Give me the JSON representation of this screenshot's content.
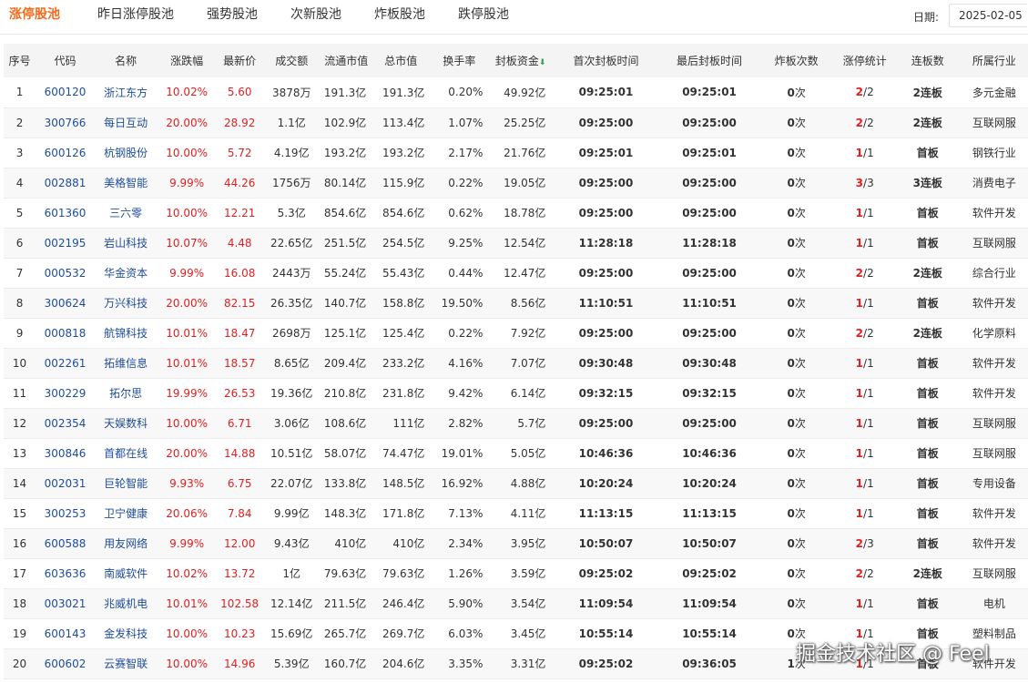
{
  "tabs": [
    "涨停股池",
    "昨日涨停股池",
    "强势股池",
    "次新股池",
    "炸板股池",
    "跌停股池"
  ],
  "date": {
    "label": "日期:",
    "value": "2025-02-05"
  },
  "table": {
    "headers": [
      "序号",
      "代码",
      "名称",
      "涨跌幅",
      "最新价",
      "成交额",
      "流通市值",
      "总市值",
      "换手率",
      "封板资金",
      "首次封板时间",
      "最后封板时间",
      "炸板次数",
      "涨停统计",
      "连板数",
      "所属行业"
    ],
    "rows": [
      {
        "idx": "1",
        "code": "600120",
        "name": "浙江东方",
        "pct": "10.02%",
        "price": "5.60",
        "amount": "3878万",
        "float_cap": "191.3亿",
        "total_cap": "191.3亿",
        "turnover": "0.20%",
        "seal": "49.92亿",
        "first": "09:25:01",
        "last": "09:25:01",
        "zb": "0",
        "zb_unit": "次",
        "zt_n": "2",
        "zt_d": "/2",
        "lb": "2连板",
        "industry": "多元金融"
      },
      {
        "idx": "2",
        "code": "300766",
        "name": "每日互动",
        "pct": "20.00%",
        "price": "28.92",
        "amount": "1.1亿",
        "float_cap": "102.9亿",
        "total_cap": "113.4亿",
        "turnover": "1.07%",
        "seal": "25.25亿",
        "first": "09:25:00",
        "last": "09:25:00",
        "zb": "0",
        "zb_unit": "次",
        "zt_n": "2",
        "zt_d": "/2",
        "lb": "2连板",
        "industry": "互联网服"
      },
      {
        "idx": "3",
        "code": "600126",
        "name": "杭钢股份",
        "pct": "10.00%",
        "price": "5.72",
        "amount": "4.19亿",
        "float_cap": "193.2亿",
        "total_cap": "193.2亿",
        "turnover": "2.17%",
        "seal": "21.76亿",
        "first": "09:25:01",
        "last": "09:25:01",
        "zb": "0",
        "zb_unit": "次",
        "zt_n": "1",
        "zt_d": "/1",
        "lb": "首板",
        "industry": "钢铁行业"
      },
      {
        "idx": "4",
        "code": "002881",
        "name": "美格智能",
        "pct": "9.99%",
        "price": "44.26",
        "amount": "1756万",
        "float_cap": "80.14亿",
        "total_cap": "115.9亿",
        "turnover": "0.22%",
        "seal": "19.05亿",
        "first": "09:25:00",
        "last": "09:25:00",
        "zb": "0",
        "zb_unit": "次",
        "zt_n": "3",
        "zt_d": "/3",
        "lb": "3连板",
        "industry": "消费电子"
      },
      {
        "idx": "5",
        "code": "601360",
        "name": "三六零",
        "pct": "10.00%",
        "price": "12.21",
        "amount": "5.3亿",
        "float_cap": "854.6亿",
        "total_cap": "854.6亿",
        "turnover": "0.62%",
        "seal": "18.78亿",
        "first": "09:25:00",
        "last": "09:25:00",
        "zb": "0",
        "zb_unit": "次",
        "zt_n": "1",
        "zt_d": "/1",
        "lb": "首板",
        "industry": "软件开发"
      },
      {
        "idx": "6",
        "code": "002195",
        "name": "岩山科技",
        "pct": "10.07%",
        "price": "4.48",
        "amount": "22.65亿",
        "float_cap": "251.5亿",
        "total_cap": "254.5亿",
        "turnover": "9.25%",
        "seal": "12.54亿",
        "first": "11:28:18",
        "last": "11:28:18",
        "zb": "0",
        "zb_unit": "次",
        "zt_n": "1",
        "zt_d": "/1",
        "lb": "首板",
        "industry": "互联网服"
      },
      {
        "idx": "7",
        "code": "000532",
        "name": "华金资本",
        "pct": "9.99%",
        "price": "16.08",
        "amount": "2443万",
        "float_cap": "55.24亿",
        "total_cap": "55.43亿",
        "turnover": "0.44%",
        "seal": "12.47亿",
        "first": "09:25:00",
        "last": "09:25:00",
        "zb": "0",
        "zb_unit": "次",
        "zt_n": "2",
        "zt_d": "/2",
        "lb": "2连板",
        "industry": "综合行业"
      },
      {
        "idx": "8",
        "code": "300624",
        "name": "万兴科技",
        "pct": "20.00%",
        "price": "82.15",
        "amount": "26.35亿",
        "float_cap": "140.7亿",
        "total_cap": "158.8亿",
        "turnover": "19.50%",
        "seal": "8.56亿",
        "first": "11:10:51",
        "last": "11:10:51",
        "zb": "0",
        "zb_unit": "次",
        "zt_n": "1",
        "zt_d": "/1",
        "lb": "首板",
        "industry": "软件开发"
      },
      {
        "idx": "9",
        "code": "000818",
        "name": "航锦科技",
        "pct": "10.01%",
        "price": "18.47",
        "amount": "2698万",
        "float_cap": "125.1亿",
        "total_cap": "125.4亿",
        "turnover": "0.22%",
        "seal": "7.92亿",
        "first": "09:25:00",
        "last": "09:25:00",
        "zb": "0",
        "zb_unit": "次",
        "zt_n": "2",
        "zt_d": "/2",
        "lb": "2连板",
        "industry": "化学原料"
      },
      {
        "idx": "10",
        "code": "002261",
        "name": "拓维信息",
        "pct": "10.01%",
        "price": "18.57",
        "amount": "8.65亿",
        "float_cap": "209.4亿",
        "total_cap": "233.2亿",
        "turnover": "4.16%",
        "seal": "7.07亿",
        "first": "09:30:48",
        "last": "09:30:48",
        "zb": "0",
        "zb_unit": "次",
        "zt_n": "1",
        "zt_d": "/1",
        "lb": "首板",
        "industry": "软件开发"
      },
      {
        "idx": "11",
        "code": "300229",
        "name": "拓尔思",
        "pct": "19.99%",
        "price": "26.53",
        "amount": "19.36亿",
        "float_cap": "210.8亿",
        "total_cap": "231.8亿",
        "turnover": "9.42%",
        "seal": "6.14亿",
        "first": "09:32:15",
        "last": "09:32:15",
        "zb": "0",
        "zb_unit": "次",
        "zt_n": "1",
        "zt_d": "/1",
        "lb": "首板",
        "industry": "软件开发"
      },
      {
        "idx": "12",
        "code": "002354",
        "name": "天娱数科",
        "pct": "10.00%",
        "price": "6.71",
        "amount": "3.06亿",
        "float_cap": "108.6亿",
        "total_cap": "111亿",
        "turnover": "2.82%",
        "seal": "5.7亿",
        "first": "09:25:00",
        "last": "09:25:00",
        "zb": "0",
        "zb_unit": "次",
        "zt_n": "1",
        "zt_d": "/1",
        "lb": "首板",
        "industry": "互联网服"
      },
      {
        "idx": "13",
        "code": "300846",
        "name": "首都在线",
        "pct": "20.00%",
        "price": "14.88",
        "amount": "10.51亿",
        "float_cap": "58.07亿",
        "total_cap": "74.47亿",
        "turnover": "19.01%",
        "seal": "5.05亿",
        "first": "10:46:36",
        "last": "10:46:36",
        "zb": "0",
        "zb_unit": "次",
        "zt_n": "1",
        "zt_d": "/1",
        "lb": "首板",
        "industry": "互联网服"
      },
      {
        "idx": "14",
        "code": "002031",
        "name": "巨轮智能",
        "pct": "9.93%",
        "price": "6.75",
        "amount": "22.07亿",
        "float_cap": "133.8亿",
        "total_cap": "148.5亿",
        "turnover": "16.92%",
        "seal": "4.88亿",
        "first": "10:20:24",
        "last": "10:20:24",
        "zb": "0",
        "zb_unit": "次",
        "zt_n": "1",
        "zt_d": "/1",
        "lb": "首板",
        "industry": "专用设备"
      },
      {
        "idx": "15",
        "code": "300253",
        "name": "卫宁健康",
        "pct": "20.06%",
        "price": "7.84",
        "amount": "9.99亿",
        "float_cap": "148.3亿",
        "total_cap": "171.8亿",
        "turnover": "7.13%",
        "seal": "4.11亿",
        "first": "11:13:15",
        "last": "11:13:15",
        "zb": "0",
        "zb_unit": "次",
        "zt_n": "1",
        "zt_d": "/1",
        "lb": "首板",
        "industry": "软件开发"
      },
      {
        "idx": "16",
        "code": "600588",
        "name": "用友网络",
        "pct": "9.99%",
        "price": "12.00",
        "amount": "9.43亿",
        "float_cap": "410亿",
        "total_cap": "410亿",
        "turnover": "2.34%",
        "seal": "3.95亿",
        "first": "10:50:07",
        "last": "10:50:07",
        "zb": "0",
        "zb_unit": "次",
        "zt_n": "2",
        "zt_d": "/3",
        "lb": "首板",
        "industry": "软件开发"
      },
      {
        "idx": "17",
        "code": "603636",
        "name": "南威软件",
        "pct": "10.02%",
        "price": "13.72",
        "amount": "1亿",
        "float_cap": "79.63亿",
        "total_cap": "79.63亿",
        "turnover": "1.26%",
        "seal": "3.59亿",
        "first": "09:25:02",
        "last": "09:25:02",
        "zb": "0",
        "zb_unit": "次",
        "zt_n": "2",
        "zt_d": "/2",
        "lb": "2连板",
        "industry": "互联网服"
      },
      {
        "idx": "18",
        "code": "003021",
        "name": "兆威机电",
        "pct": "10.01%",
        "price": "102.58",
        "amount": "12.14亿",
        "float_cap": "211.5亿",
        "total_cap": "246.4亿",
        "turnover": "5.90%",
        "seal": "3.54亿",
        "first": "11:09:54",
        "last": "11:09:54",
        "zb": "0",
        "zb_unit": "次",
        "zt_n": "1",
        "zt_d": "/1",
        "lb": "首板",
        "industry": "电机"
      },
      {
        "idx": "19",
        "code": "600143",
        "name": "金发科技",
        "pct": "10.00%",
        "price": "10.23",
        "amount": "15.69亿",
        "float_cap": "265.7亿",
        "total_cap": "269.7亿",
        "turnover": "6.03%",
        "seal": "3.45亿",
        "first": "10:55:14",
        "last": "10:55:14",
        "zb": "0",
        "zb_unit": "次",
        "zt_n": "1",
        "zt_d": "/1",
        "lb": "首板",
        "industry": "塑料制品"
      },
      {
        "idx": "20",
        "code": "600602",
        "name": "云赛智联",
        "pct": "10.00%",
        "price": "14.96",
        "amount": "5.39亿",
        "float_cap": "160.7亿",
        "total_cap": "204.6亿",
        "turnover": "3.35%",
        "seal": "3.31亿",
        "first": "09:25:02",
        "last": "09:36:05",
        "zb": "1",
        "zb_unit": "次",
        "zt_n": "1",
        "zt_d": "/1",
        "lb": "首板",
        "industry": "软件开发"
      }
    ]
  },
  "watermark": "掘金技术社区 @ Feel",
  "colors": {
    "accent": "#f26b1d",
    "code": "#1f4c9a",
    "up": "#e02020",
    "sort_arrow": "#2aa34a"
  },
  "icons": {
    "sort": "sort-down-arrow-icon"
  }
}
